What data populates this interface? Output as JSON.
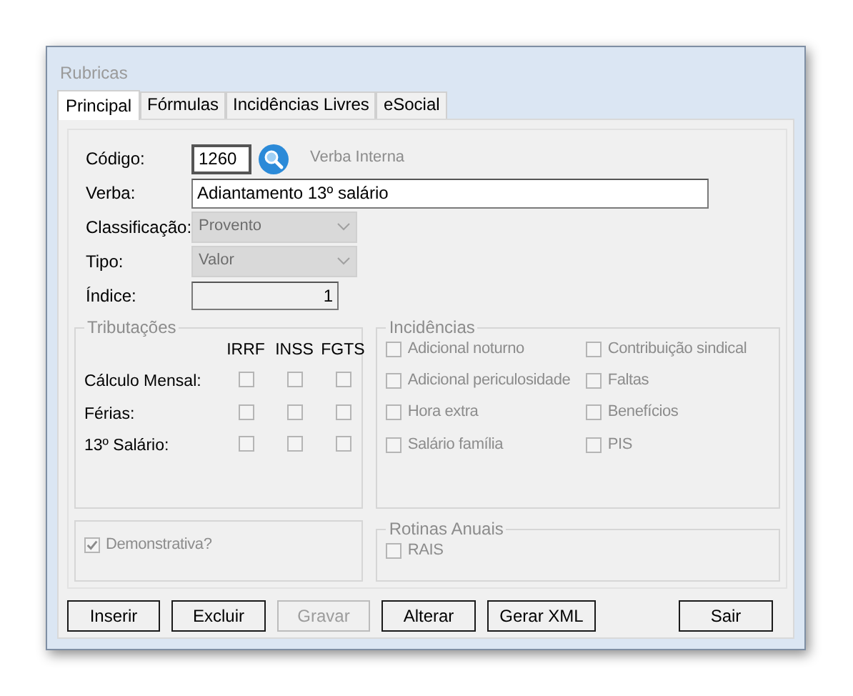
{
  "window": {
    "title": "Rubricas"
  },
  "tabs": [
    {
      "label": "Principal",
      "selected": true
    },
    {
      "label": "Fórmulas",
      "selected": false
    },
    {
      "label": "Incidências Livres",
      "selected": false
    },
    {
      "label": "eSocial",
      "selected": false
    }
  ],
  "codigo": {
    "label": "Código:",
    "value": "1260",
    "note": "Verba Interna"
  },
  "fields": [
    {
      "kind": "text",
      "label": "Verba:",
      "value": "Adiantamento 13º salário"
    },
    {
      "kind": "select",
      "label": "Classificação:",
      "value": "Provento",
      "disabled": true
    },
    {
      "kind": "select",
      "label": "Tipo:",
      "value": "Valor",
      "disabled": true
    },
    {
      "kind": "number",
      "label": "Índice:",
      "value": "1",
      "disabled": true
    }
  ],
  "tributacoes": {
    "title": "Tributações",
    "columns": [
      "IRRF",
      "INSS",
      "FGTS"
    ],
    "disabled": true,
    "rows": [
      {
        "label": "Cálculo Mensal:",
        "checks": [
          false,
          false,
          false
        ]
      },
      {
        "label": "Férias:",
        "checks": [
          false,
          false,
          false
        ]
      },
      {
        "label": "13º Salário:",
        "checks": [
          false,
          false,
          false
        ]
      }
    ]
  },
  "incidencias": {
    "title": "Incidências",
    "disabled": true,
    "items": [
      {
        "label": "Adicional noturno",
        "checked": false
      },
      {
        "label": "Contribuição sindical",
        "checked": false
      },
      {
        "label": "Adicional periculosidade",
        "checked": false
      },
      {
        "label": "Faltas",
        "checked": false
      },
      {
        "label": "Hora extra",
        "checked": false
      },
      {
        "label": "Benefícios",
        "checked": false
      },
      {
        "label": "Salário família",
        "checked": false
      },
      {
        "label": "PIS",
        "checked": false
      }
    ]
  },
  "demonstrativa": {
    "label": "Demonstrativa?",
    "checked": true,
    "disabled": true
  },
  "rotinas_anuais": {
    "title": "Rotinas Anuais",
    "disabled": true,
    "items": [
      {
        "label": "RAIS",
        "checked": false
      }
    ]
  },
  "buttons": [
    {
      "label": "Inserir",
      "disabled": false
    },
    {
      "label": "Excluir",
      "disabled": false
    },
    {
      "label": "Gravar",
      "disabled": true
    },
    {
      "label": "Alterar",
      "disabled": false
    },
    {
      "label": "Gerar XML",
      "disabled": false
    },
    {
      "label": "Sair",
      "disabled": false,
      "kind": "right"
    }
  ]
}
